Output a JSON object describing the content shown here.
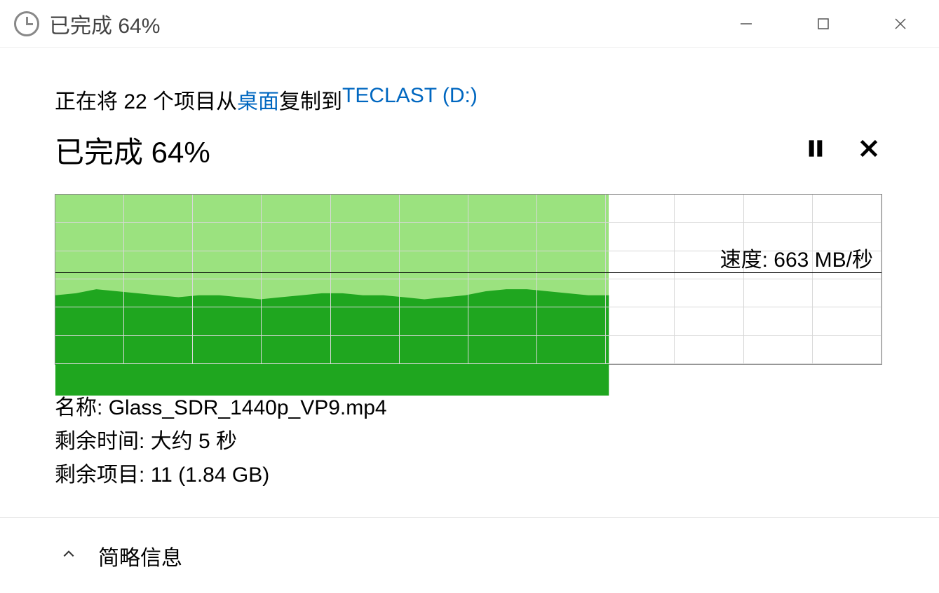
{
  "window": {
    "title": "已完成 64%"
  },
  "copy": {
    "prefix": "正在将 22 个项目从 ",
    "source": "桌面",
    "middle": " 复制到 ",
    "dest": "TECLAST (D:)"
  },
  "progress": {
    "text": "已完成 64%",
    "percent": 64
  },
  "chart_data": {
    "type": "area",
    "percent_complete": 64,
    "speed_line_y_percent": 46,
    "speed_label": "速度: 663 MB/秒",
    "speed_history_percent": [
      50,
      51,
      53,
      52,
      51,
      50,
      49,
      50,
      50,
      49,
      48,
      49,
      50,
      51,
      51,
      50,
      50,
      49,
      48,
      49,
      50,
      52,
      53,
      53,
      52,
      51,
      50,
      50
    ]
  },
  "details": {
    "name_label": "名称:",
    "name_value": "Glass_SDR_1440p_VP9.mp4",
    "time_label": "剩余时间:",
    "time_value": "大约 5 秒",
    "items_label": "剩余项目:",
    "items_value": "11 (1.84 GB)"
  },
  "footer": {
    "label": "简略信息"
  },
  "colors": {
    "link": "#0067c0",
    "progress_light": "#9be27f",
    "progress_dark": "#1fa61f"
  }
}
